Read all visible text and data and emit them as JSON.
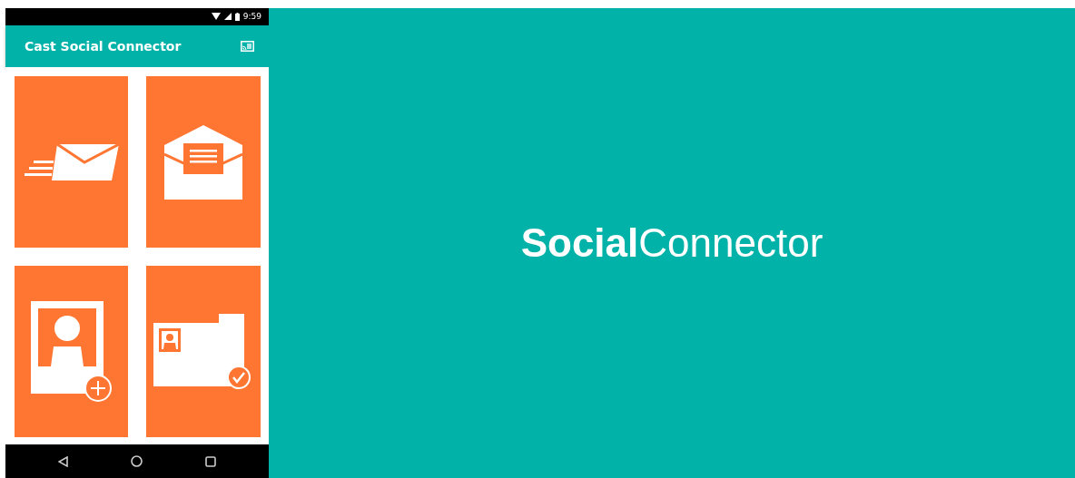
{
  "status_bar": {
    "time": "9:59"
  },
  "app_bar": {
    "title": "Cast Social Connector"
  },
  "tiles": [
    {
      "kind": "send-mail"
    },
    {
      "kind": "open-mail"
    },
    {
      "kind": "add-contact"
    },
    {
      "kind": "contact-folder"
    }
  ],
  "splash": {
    "title": "**Social**Connector"
  }
}
